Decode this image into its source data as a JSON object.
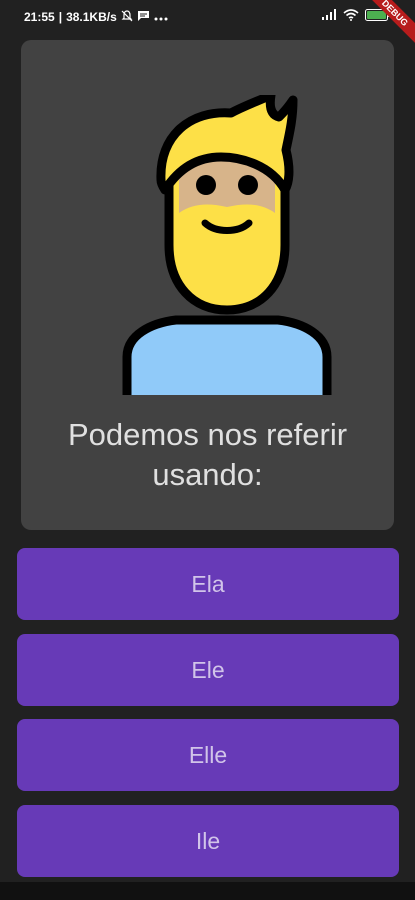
{
  "status_bar": {
    "time": "21:55",
    "network_speed": "38.1KB/s",
    "battery_level": "100",
    "debug_label": "DEBUG"
  },
  "icons": {
    "notification_muted": "bell-off-icon",
    "message": "message-icon",
    "more": "more-dots-icon",
    "signal": "signal-icon",
    "wifi": "wifi-icon",
    "battery": "battery-icon",
    "avatar": "bearded-man-emoji"
  },
  "quiz": {
    "question": "Podemos nos referir\nusando:",
    "options": [
      "Ela",
      "Ele",
      "Elle",
      "Ile"
    ]
  },
  "colors": {
    "background": "#212121",
    "card": "#424242",
    "option_button": "#673ab7",
    "option_text": "#d1c4e9",
    "debug_banner": "#b71c1c"
  }
}
